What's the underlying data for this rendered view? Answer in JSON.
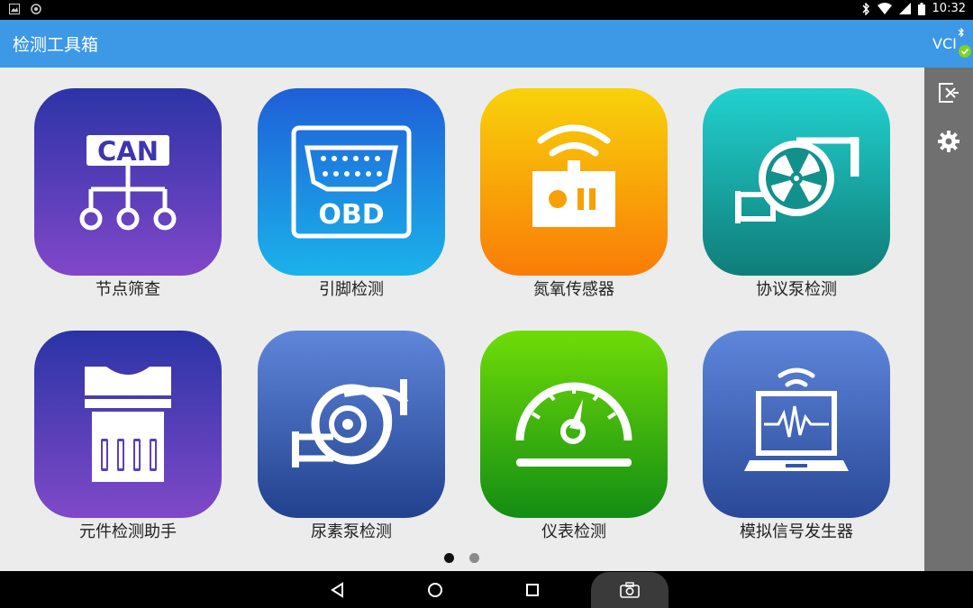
{
  "status_bar": {
    "time": "10:32"
  },
  "app_bar": {
    "title": "检测工具箱"
  },
  "side_bar": {
    "vci_label": "VCI"
  },
  "tiles": [
    {
      "label": "节点筛查",
      "icon_text": "CAN",
      "icon": "can-network-icon"
    },
    {
      "label": "引脚检测",
      "icon_text": "OBD",
      "icon": "obd-connector-icon"
    },
    {
      "label": "氮氧传感器",
      "icon": "nox-sensor-icon"
    },
    {
      "label": "协议泵检测",
      "icon": "protocol-pump-icon"
    },
    {
      "label": "元件检测助手",
      "icon": "component-chip-icon"
    },
    {
      "label": "尿素泵检测",
      "icon": "urea-pump-icon"
    },
    {
      "label": "仪表检测",
      "icon": "gauge-icon"
    },
    {
      "label": "模拟信号发生器",
      "icon": "signal-generator-icon"
    }
  ],
  "pagination": {
    "pages": 2,
    "current": 1
  },
  "colors": {
    "app_bar": "#3d98e6",
    "side_bar": "#707070",
    "content_bg": "#ececec"
  }
}
